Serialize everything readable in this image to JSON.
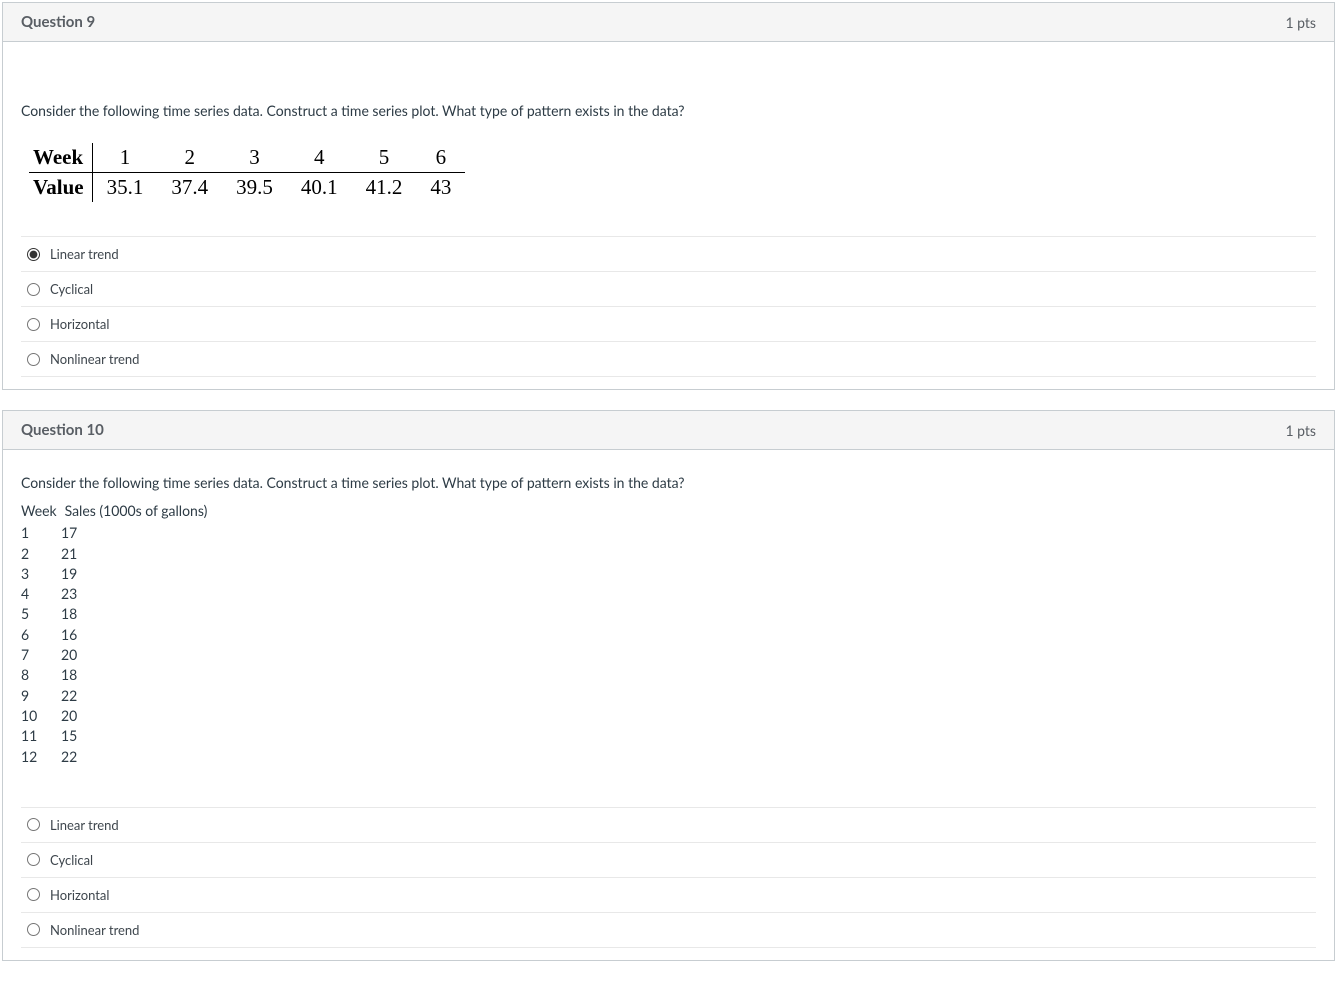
{
  "q9": {
    "title": "Question 9",
    "pts": "1 pts",
    "prompt": "Consider the following time series data. Construct a time series plot. What type of pattern exists in the data?",
    "table": {
      "row1_label": "Week",
      "row1": [
        "1",
        "2",
        "3",
        "4",
        "5",
        "6"
      ],
      "row2_label": "Value",
      "row2": [
        "35.1",
        "37.4",
        "39.5",
        "40.1",
        "41.2",
        "43"
      ]
    },
    "answers": [
      {
        "label": "Linear trend",
        "selected": true
      },
      {
        "label": "Cyclical",
        "selected": false
      },
      {
        "label": "Horizontal",
        "selected": false
      },
      {
        "label": "Nonlinear trend",
        "selected": false
      }
    ]
  },
  "q10": {
    "title": "Question 10",
    "pts": "1 pts",
    "prompt": "Consider the following time series data. Construct a time series plot. What type of pattern exists in the data?",
    "data_header_col1": "Week",
    "data_header_col2": "Sales (1000s of gallons)",
    "data_rows": [
      {
        "week": "1",
        "value": "17"
      },
      {
        "week": "2",
        "value": "21"
      },
      {
        "week": "3",
        "value": "19"
      },
      {
        "week": "4",
        "value": "23"
      },
      {
        "week": "5",
        "value": "18"
      },
      {
        "week": "6",
        "value": "16"
      },
      {
        "week": "7",
        "value": "20"
      },
      {
        "week": "8",
        "value": "18"
      },
      {
        "week": "9",
        "value": "22"
      },
      {
        "week": "10",
        "value": "20"
      },
      {
        "week": "11",
        "value": "15"
      },
      {
        "week": "12",
        "value": "22"
      }
    ],
    "answers": [
      {
        "label": "Linear trend",
        "selected": false
      },
      {
        "label": "Cyclical",
        "selected": false
      },
      {
        "label": "Horizontal",
        "selected": false
      },
      {
        "label": "Nonlinear trend",
        "selected": false
      }
    ]
  },
  "chart_data": [
    {
      "type": "table",
      "title": "Question 9 time series",
      "categories": [
        1,
        2,
        3,
        4,
        5,
        6
      ],
      "values": [
        35.1,
        37.4,
        39.5,
        40.1,
        41.2,
        43
      ],
      "xlabel": "Week",
      "ylabel": "Value"
    },
    {
      "type": "table",
      "title": "Question 10 time series",
      "categories": [
        1,
        2,
        3,
        4,
        5,
        6,
        7,
        8,
        9,
        10,
        11,
        12
      ],
      "values": [
        17,
        21,
        19,
        23,
        18,
        16,
        20,
        18,
        22,
        20,
        15,
        22
      ],
      "xlabel": "Week",
      "ylabel": "Sales (1000s of gallons)"
    }
  ]
}
